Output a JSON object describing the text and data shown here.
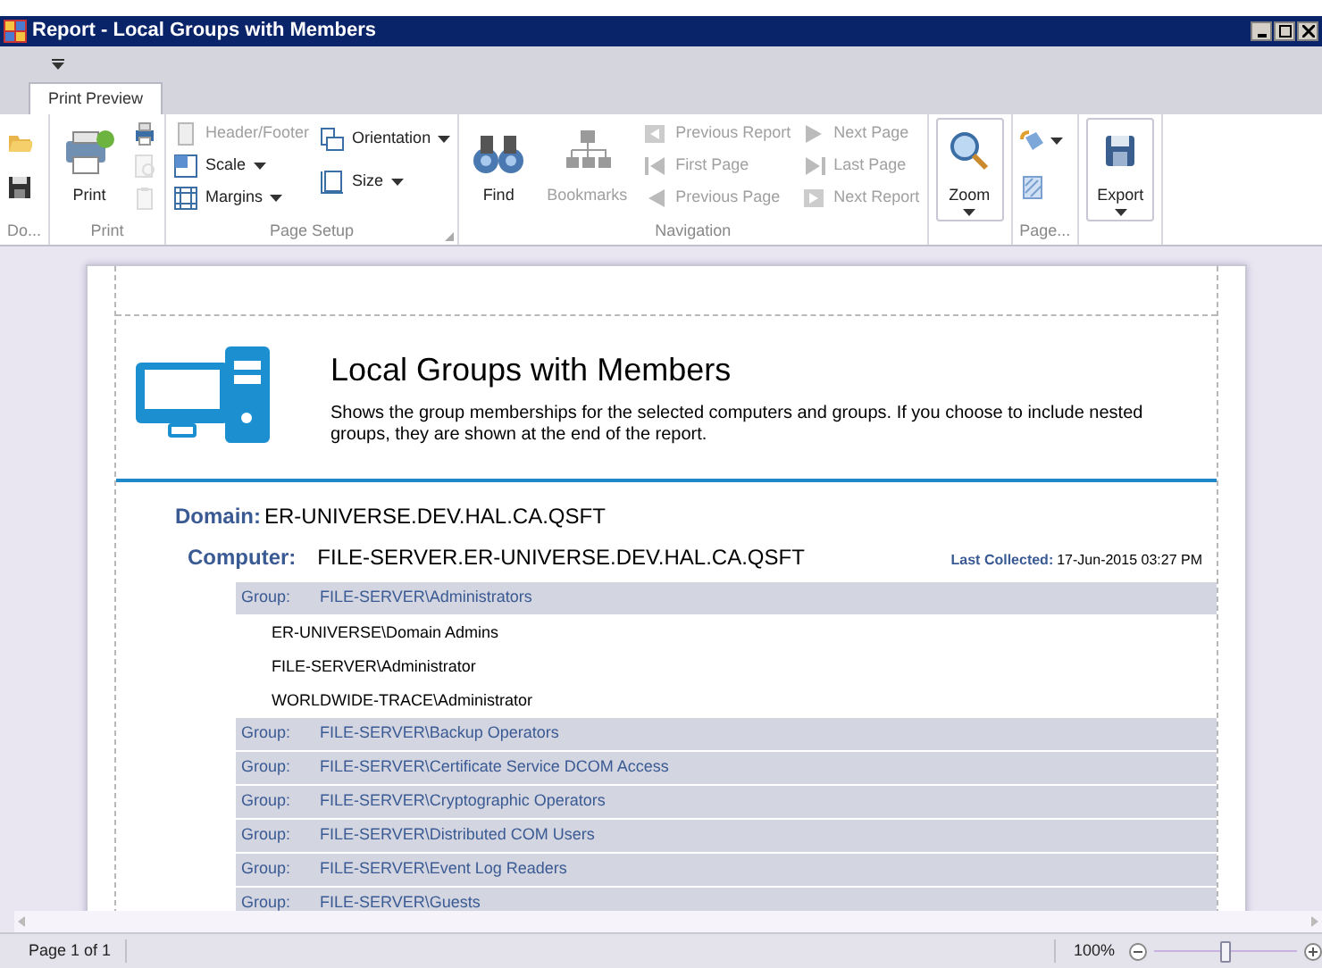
{
  "window": {
    "title": "Report - Local Groups with Members"
  },
  "tabs": [
    {
      "label": "Print Preview",
      "selected": true
    }
  ],
  "ribbon": {
    "groups": [
      {
        "label": "Do...",
        "columns": [
          [
            {
              "kind": "icon",
              "disabled": false
            },
            {
              "kind": "icon",
              "disabled": false
            }
          ]
        ]
      },
      {
        "label": "Print",
        "columns": [
          [
            {
              "kind": "large",
              "label": "Print",
              "disabled": false
            }
          ],
          [
            {
              "kind": "icon",
              "disabled": false
            },
            {
              "kind": "icon",
              "disabled": true
            },
            {
              "kind": "icon",
              "disabled": true
            }
          ]
        ]
      },
      {
        "label": "Page Setup",
        "launcher": true,
        "columns": [
          [
            {
              "kind": "small",
              "label": "Header/Footer",
              "disabled": true
            },
            {
              "kind": "small",
              "label": "Scale",
              "dropdown": true,
              "disabled": false
            },
            {
              "kind": "small",
              "label": "Margins",
              "dropdown": true,
              "disabled": false
            }
          ],
          [
            {
              "kind": "small",
              "label": "Orientation",
              "dropdown": true,
              "disabled": false
            },
            {
              "kind": "small",
              "label": "Size",
              "dropdown": true,
              "disabled": false
            }
          ]
        ]
      },
      {
        "label": "Navigation",
        "columns": [
          [
            {
              "kind": "large",
              "label": "Find",
              "disabled": false
            }
          ],
          [
            {
              "kind": "large",
              "label": "Bookmarks",
              "disabled": true
            }
          ],
          [
            {
              "kind": "small",
              "label": "Previous Report",
              "disabled": true
            },
            {
              "kind": "small",
              "label": "First Page",
              "disabled": true
            },
            {
              "kind": "small",
              "label": "Previous Page",
              "disabled": true
            }
          ],
          [
            {
              "kind": "small",
              "label": "Next  Page",
              "disabled": true
            },
            {
              "kind": "small",
              "label": "Last  Page",
              "disabled": true
            },
            {
              "kind": "small",
              "label": "Next Report",
              "disabled": true
            }
          ]
        ]
      },
      {
        "columns": [
          [
            {
              "kind": "large",
              "label": "Zoom",
              "dropdown": true,
              "framed": true,
              "disabled": false
            }
          ]
        ]
      },
      {
        "label": "Page...",
        "columns": [
          [
            {
              "kind": "icon",
              "dropdown": true,
              "disabled": false
            },
            {
              "kind": "icon",
              "disabled": false
            }
          ]
        ]
      },
      {
        "columns": [
          [
            {
              "kind": "large",
              "label": "Export",
              "dropdown": true,
              "framed": true,
              "disabled": false
            }
          ]
        ]
      }
    ]
  },
  "report": {
    "title": "Local Groups with Members",
    "description": "Shows the group memberships for the selected computers and groups. If you choose to include nested groups, they are shown at the end of the report.",
    "domain_label": "Domain:",
    "domain": "ER-UNIVERSE.DEV.HAL.CA.QSFT",
    "computer_label": "Computer:",
    "computer": "FILE-SERVER.ER-UNIVERSE.DEV.HAL.CA.QSFT",
    "last_collected_label": "Last Collected:",
    "last_collected": "17-Jun-2015 03:27 PM",
    "groups": [
      {
        "label": "Group:",
        "name": "FILE-SERVER\\Administrators",
        "members": [
          "ER-UNIVERSE\\Domain Admins",
          "FILE-SERVER\\Administrator",
          "WORLDWIDE-TRACE\\Administrator"
        ]
      },
      {
        "label": "Group:",
        "name": "FILE-SERVER\\Backup Operators"
      },
      {
        "label": "Group:",
        "name": "FILE-SERVER\\Certificate Service DCOM Access"
      },
      {
        "label": "Group:",
        "name": "FILE-SERVER\\Cryptographic Operators"
      },
      {
        "label": "Group:",
        "name": "FILE-SERVER\\Distributed COM Users"
      },
      {
        "label": "Group:",
        "name": "FILE-SERVER\\Event Log Readers"
      },
      {
        "label": "Group:",
        "name": "FILE-SERVER\\Guests"
      }
    ]
  },
  "status": {
    "page": "Page 1 of 1",
    "zoom": {
      "reading": "100%",
      "level": 0.5
    }
  }
}
